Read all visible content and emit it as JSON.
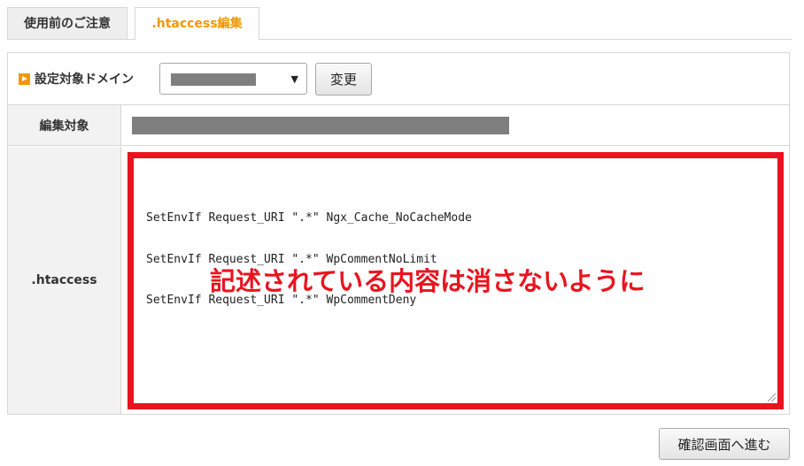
{
  "tabs": [
    {
      "label": "使用前のご注意",
      "active": false
    },
    {
      "label": ".htaccess編集",
      "active": true
    }
  ],
  "domain_row": {
    "label": "設定対象ドメイン",
    "change_button": "変更"
  },
  "target_row": {
    "label": "編集対象"
  },
  "htaccess_row": {
    "label": ".htaccess",
    "lines": [
      "SetEnvIf Request_URI \".*\" Ngx_Cache_NoCacheMode",
      "SetEnvIf Request_URI \".*\" WpCommentNoLimit",
      "SetEnvIf Request_URI \".*\" WpCommentDeny"
    ],
    "annotation": "記述されている内容は消さないように"
  },
  "confirm_button": "確認画面へ進む",
  "colors": {
    "accent": "#f39700",
    "annotation_red": "#e8141e"
  }
}
